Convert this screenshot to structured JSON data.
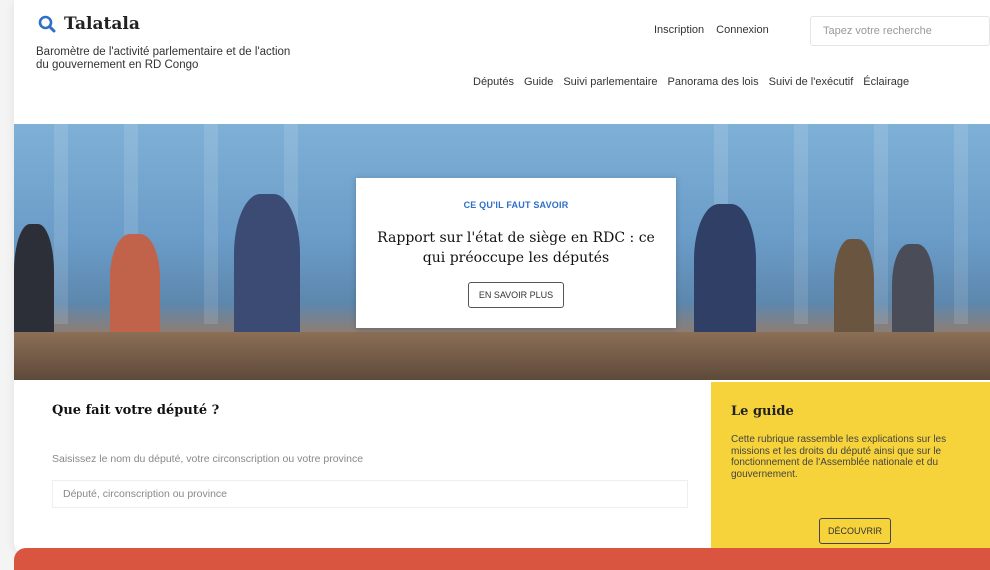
{
  "header": {
    "logo_text": "Talatala",
    "tagline": "Baromètre de l'activité parlementaire et de l'action du gouvernement en RD Congo",
    "top_links": [
      "Inscription",
      "Connexion"
    ],
    "search_placeholder": "Tapez votre recherche"
  },
  "nav": {
    "items": [
      "Députés",
      "Guide",
      "Suivi parlementaire",
      "Panorama des lois",
      "Suivi de l'exécutif",
      "Éclairage"
    ]
  },
  "hero": {
    "eyebrow": "CE QU'IL FAUT SAVOIR",
    "title": "Rapport sur l'état de siège en RDC : ce qui préoccupe les députés",
    "button": "EN SAVOIR PLUS"
  },
  "deputy_search": {
    "title": "Que fait votre député ?",
    "subtitle": "Saisissez le nom du député, votre circonscription ou votre province",
    "placeholder": "Député, circonscription ou province"
  },
  "guide": {
    "title": "Le guide",
    "text": "Cette rubrique rassemble les explications sur les missions et les droits du député ainsi que sur le fonctionnement de l'Assemblée nationale et du gouvernement.",
    "button": "DÉCOUVRIR"
  },
  "colors": {
    "accent_blue": "#2e6fc7",
    "guide_yellow": "#f6d33a",
    "bottom_bar": "#d9553f"
  },
  "icons": {
    "logo": "magnifier-icon"
  }
}
